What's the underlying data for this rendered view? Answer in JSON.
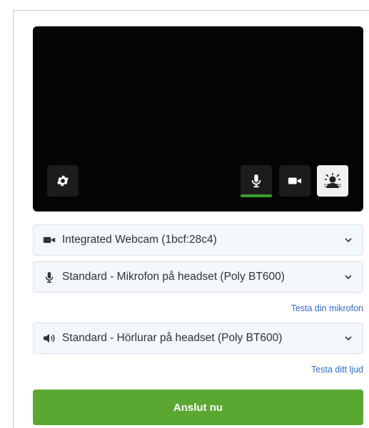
{
  "devices": {
    "camera": {
      "label": "Integrated Webcam (1bcf:28c4)",
      "icon": "video-camera-icon"
    },
    "microphone": {
      "label": "Standard - Mikrofon på headset (Poly BT600)",
      "icon": "microphone-icon"
    },
    "speaker": {
      "label": "Standard - Hörlurar på headset (Poly BT600)",
      "icon": "speaker-icon"
    }
  },
  "links": {
    "test_mic": "Testa din mikrofon",
    "test_audio": "Testa ditt ljud"
  },
  "actions": {
    "join": "Anslut nu"
  },
  "colors": {
    "accent": "#5aa832",
    "link": "#2f6bdc",
    "mic_level": "#38a22e"
  }
}
